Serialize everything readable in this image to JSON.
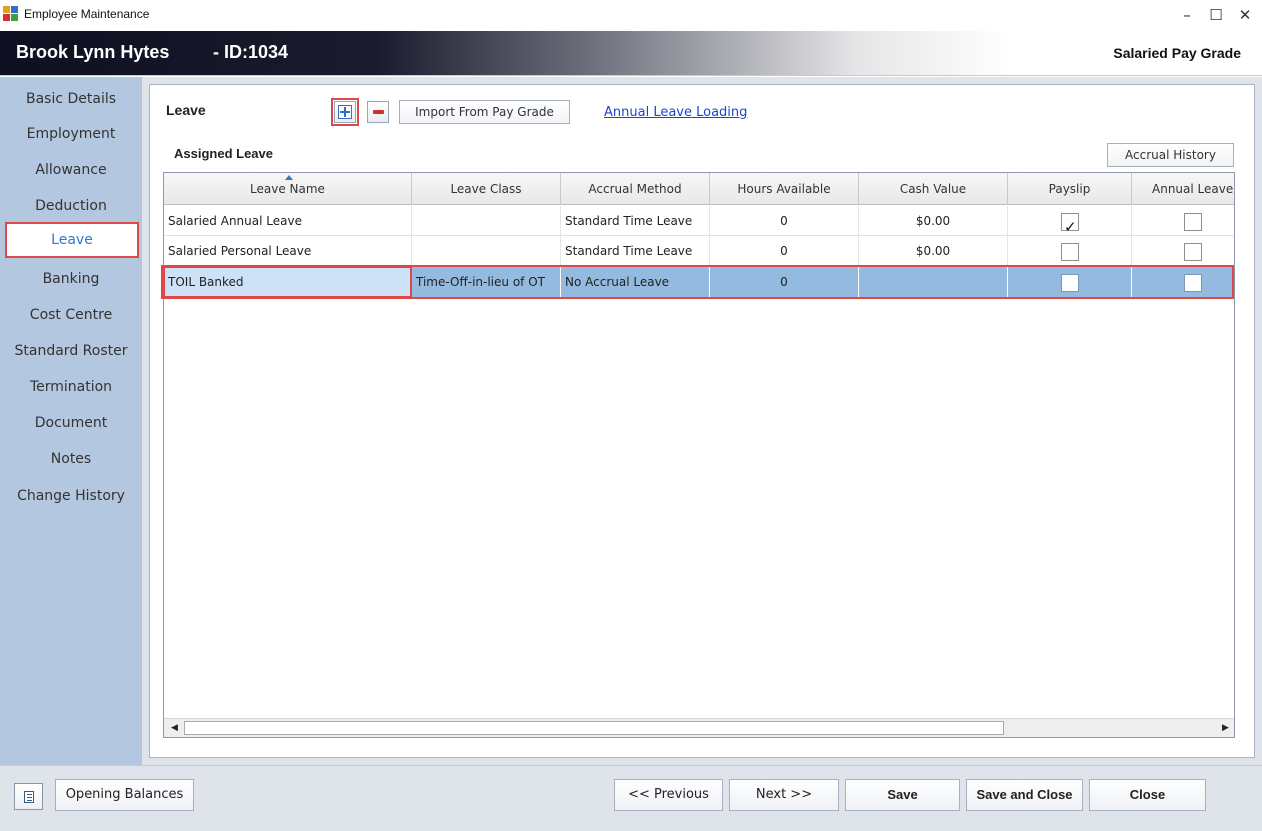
{
  "window": {
    "title": "Employee Maintenance",
    "min": "–",
    "max": "☐",
    "close": "✕"
  },
  "header": {
    "employee_name": "Brook Lynn Hytes",
    "employee_id": "- ID:1034",
    "pay_grade": "Salaried Pay Grade",
    "gradient_colors": [
      "#0e1022",
      "#6e707c",
      "#ffffff"
    ]
  },
  "sidebar": {
    "items": [
      {
        "label": "Basic Details"
      },
      {
        "label": "Employment"
      },
      {
        "label": "Allowance"
      },
      {
        "label": "Deduction"
      },
      {
        "label": "Leave",
        "active": true
      },
      {
        "label": "Banking"
      },
      {
        "label": "Cost Centre"
      },
      {
        "label": "Standard Roster"
      },
      {
        "label": "Termination"
      },
      {
        "label": "Document"
      },
      {
        "label": "Notes"
      },
      {
        "label": "Change History"
      }
    ]
  },
  "leave": {
    "title": "Leave",
    "add_icon": "plus-icon",
    "remove_icon": "minus-icon",
    "import_label": "Import From Pay Grade",
    "annual_loading_link": "Annual Leave Loading",
    "assigned_title": "Assigned Leave",
    "accrual_history_label": "Accrual History"
  },
  "grid": {
    "columns": [
      "Leave Name",
      "Leave Class",
      "Accrual Method",
      "Hours Available",
      "Cash Value",
      "Payslip",
      "Annual Leave"
    ],
    "sorted_column": "Leave Name",
    "rows": [
      {
        "name": "Salaried Annual Leave",
        "class": "",
        "method": "Standard Time Leave",
        "hours": "0",
        "cash": "$0.00",
        "payslip": true,
        "annual": false
      },
      {
        "name": "Salaried Personal Leave",
        "class": "",
        "method": "Standard Time Leave",
        "hours": "0",
        "cash": "$0.00",
        "payslip": false,
        "annual": false
      },
      {
        "name": "TOIL Banked",
        "class": "Time-Off-in-lieu of OT",
        "method": "No Accrual Leave",
        "hours": "0",
        "cash": "",
        "payslip": false,
        "annual": false,
        "selected": true
      }
    ],
    "scroll_left": "◀",
    "scroll_right": "▶"
  },
  "footer": {
    "opening_balances_label": "Opening Balances",
    "previous_label": "<< Previous",
    "next_label": "Next >>",
    "save_label": "Save",
    "save_close_label": "Save and Close",
    "close_label": "Close"
  },
  "colors": {
    "sidebar": "#b4c7e0",
    "highlight": "#e04848",
    "link": "#1a44d6",
    "selected_row": "#94bbdf"
  }
}
